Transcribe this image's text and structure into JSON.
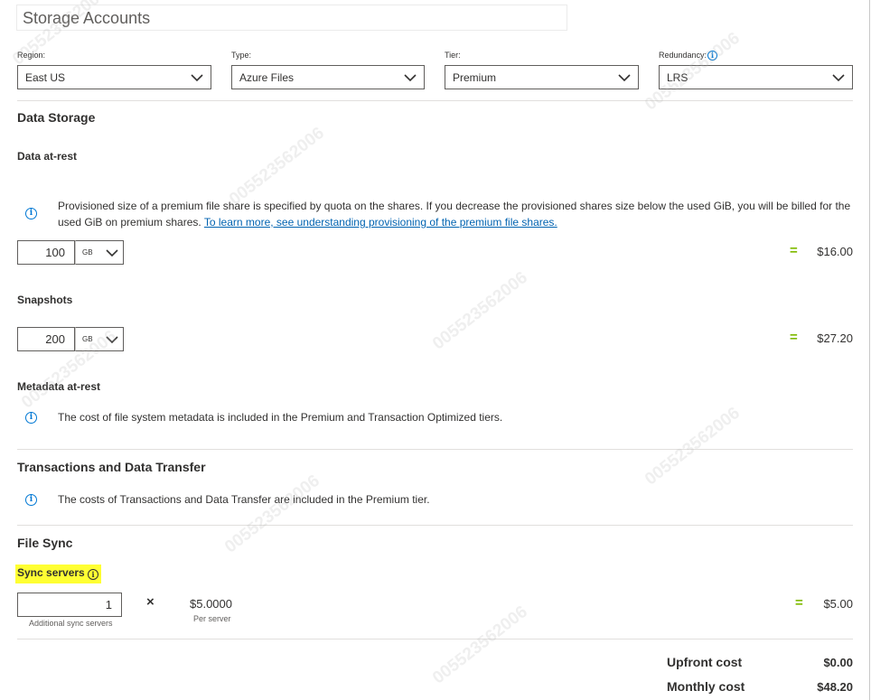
{
  "header": {
    "title": "Storage Accounts"
  },
  "filters": {
    "region": {
      "label": "Region:",
      "value": "East US"
    },
    "type": {
      "label": "Type:",
      "value": "Azure Files"
    },
    "tier": {
      "label": "Tier:",
      "value": "Premium"
    },
    "redundancy": {
      "label": "Redundancy:",
      "value": "LRS"
    }
  },
  "data_storage": {
    "title": "Data Storage",
    "at_rest": {
      "title": "Data at-rest",
      "info_text": "Provisioned size of a premium file share is specified by quota on the shares. If you decrease the provisioned shares size below the used GiB, you will be billed for the used GiB on premium shares.",
      "info_link": "To learn more, see understanding provisioning of the premium file shares.",
      "quantity": "100",
      "unit": "GB",
      "price": "$16.00"
    },
    "snapshots": {
      "title": "Snapshots",
      "quantity": "200",
      "unit": "GB",
      "price": "$27.20"
    },
    "metadata": {
      "title": "Metadata at-rest",
      "info_text": "The cost of file system metadata is included in the Premium and Transaction Optimized tiers."
    }
  },
  "transactions": {
    "title": "Transactions and Data Transfer",
    "info_text": "The costs of Transactions and Data Transfer are included in the Premium tier."
  },
  "file_sync": {
    "title": "File Sync",
    "sync_servers_label": "Sync servers",
    "quantity": "1",
    "quantity_caption": "Additional sync servers",
    "multiply": "×",
    "unit_price": "$5.0000",
    "unit_price_caption": "Per server",
    "equals": "=",
    "price": "$5.00"
  },
  "totals": {
    "upfront_label": "Upfront cost",
    "upfront_value": "$0.00",
    "monthly_label": "Monthly cost",
    "monthly_value": "$48.20"
  },
  "symbols": {
    "equals": "=",
    "info": "i"
  },
  "watermark": "005523562006",
  "colors": {
    "accent": "#0078d4",
    "equals": "#7fba00",
    "highlight": "#ffff33"
  }
}
